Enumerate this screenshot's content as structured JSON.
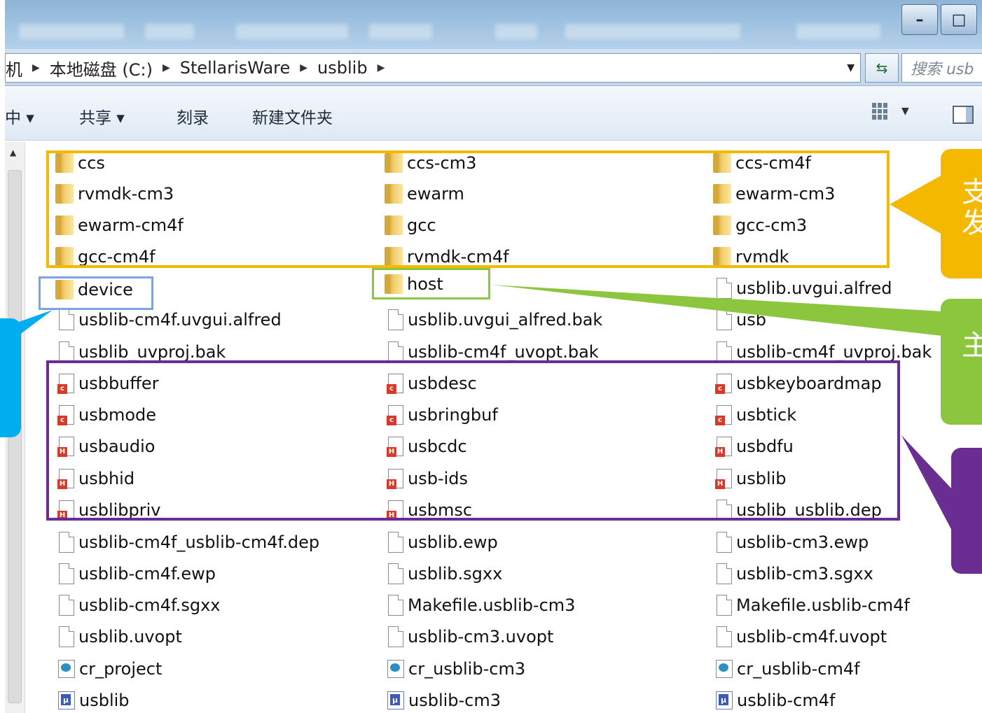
{
  "address": {
    "crumbs": [
      "机",
      "本地磁盘 (C:)",
      "StellarisWare",
      "usblib"
    ],
    "search_placeholder": "搜索 usb"
  },
  "toolbar": {
    "organize": "中 ▾",
    "share": "共享 ▾",
    "burn": "刻录",
    "new_folder": "新建文件夹"
  },
  "window_controls": {
    "minimize": "–",
    "maximize": "□"
  },
  "files": {
    "col1": [
      {
        "name": "ccs",
        "type": "folder"
      },
      {
        "name": "rvmdk-cm3",
        "type": "folder"
      },
      {
        "name": "ewarm-cm4f",
        "type": "folder"
      },
      {
        "name": "gcc-cm4f",
        "type": "folder"
      },
      {
        "name": "device",
        "type": "folder"
      },
      {
        "name": "usblib-cm4f.uvgui.alfred",
        "type": "doc"
      },
      {
        "name": "usblib_uvproj.bak",
        "type": "doc"
      },
      {
        "name": "usbbuffer",
        "type": "c"
      },
      {
        "name": "usbmode",
        "type": "c"
      },
      {
        "name": "usbaudio",
        "type": "h"
      },
      {
        "name": "usbhid",
        "type": "h"
      },
      {
        "name": "usblibpriv",
        "type": "h"
      },
      {
        "name": "usblib-cm4f_usblib-cm4f.dep",
        "type": "doc"
      },
      {
        "name": "usblib-cm4f.ewp",
        "type": "doc"
      },
      {
        "name": "usblib-cm4f.sgxx",
        "type": "doc"
      },
      {
        "name": "usblib.uvopt",
        "type": "doc"
      },
      {
        "name": "cr_project",
        "type": "cfg"
      },
      {
        "name": "usblib",
        "type": "proj"
      }
    ],
    "col2": [
      {
        "name": "ccs-cm3",
        "type": "folder"
      },
      {
        "name": "ewarm",
        "type": "folder"
      },
      {
        "name": "gcc",
        "type": "folder"
      },
      {
        "name": "rvmdk-cm4f",
        "type": "folder"
      },
      {
        "name": "host",
        "type": "folder"
      },
      {
        "name": "usblib.uvgui_alfred.bak",
        "type": "doc"
      },
      {
        "name": "usblib-cm4f_uvopt.bak",
        "type": "doc"
      },
      {
        "name": "usbdesc",
        "type": "c"
      },
      {
        "name": "usbringbuf",
        "type": "c"
      },
      {
        "name": "usbcdc",
        "type": "h"
      },
      {
        "name": "usb-ids",
        "type": "h"
      },
      {
        "name": "usbmsc",
        "type": "h"
      },
      {
        "name": "usblib.ewp",
        "type": "doc"
      },
      {
        "name": "usblib.sgxx",
        "type": "doc"
      },
      {
        "name": "Makefile.usblib-cm3",
        "type": "doc"
      },
      {
        "name": "usblib-cm3.uvopt",
        "type": "doc"
      },
      {
        "name": "cr_usblib-cm3",
        "type": "cfg"
      },
      {
        "name": "usblib-cm3",
        "type": "proj"
      }
    ],
    "col3": [
      {
        "name": "ccs-cm4f",
        "type": "folder"
      },
      {
        "name": "ewarm-cm3",
        "type": "folder"
      },
      {
        "name": "gcc-cm3",
        "type": "folder"
      },
      {
        "name": "rvmdk",
        "type": "folder"
      },
      {
        "name": "usblib.uvgui.alfred",
        "type": "doc"
      },
      {
        "name": "usb",
        "type": "doc"
      },
      {
        "name": "usblib-cm4f_uvproj.bak",
        "type": "doc"
      },
      {
        "name": "usbkeyboardmap",
        "type": "c"
      },
      {
        "name": "usbtick",
        "type": "c"
      },
      {
        "name": "usbdfu",
        "type": "h"
      },
      {
        "name": "usblib",
        "type": "h"
      },
      {
        "name": "usblib_usblib.dep",
        "type": "doc"
      },
      {
        "name": "usblib-cm3.ewp",
        "type": "doc"
      },
      {
        "name": "usblib-cm3.sgxx",
        "type": "doc"
      },
      {
        "name": "Makefile.usblib-cm4f",
        "type": "doc"
      },
      {
        "name": "usblib-cm4f.uvopt",
        "type": "doc"
      },
      {
        "name": "cr_usblib-cm4f",
        "type": "cfg"
      },
      {
        "name": "usblib-cm4f",
        "type": "proj"
      }
    ]
  },
  "callouts": {
    "yellow": {
      "line1": "支",
      "line2": "发",
      "color": "#f5b800"
    },
    "green": {
      "line1": "主",
      "color": "#8cc63f"
    },
    "purple": {
      "color": "#6a2d91"
    },
    "blue": {
      "color": "#00aeef"
    }
  },
  "colors": {
    "box_yellow": "#f5b800",
    "box_green": "#8cc63f",
    "box_purple": "#6a2d91",
    "box_blue": "#7fa3e0"
  }
}
